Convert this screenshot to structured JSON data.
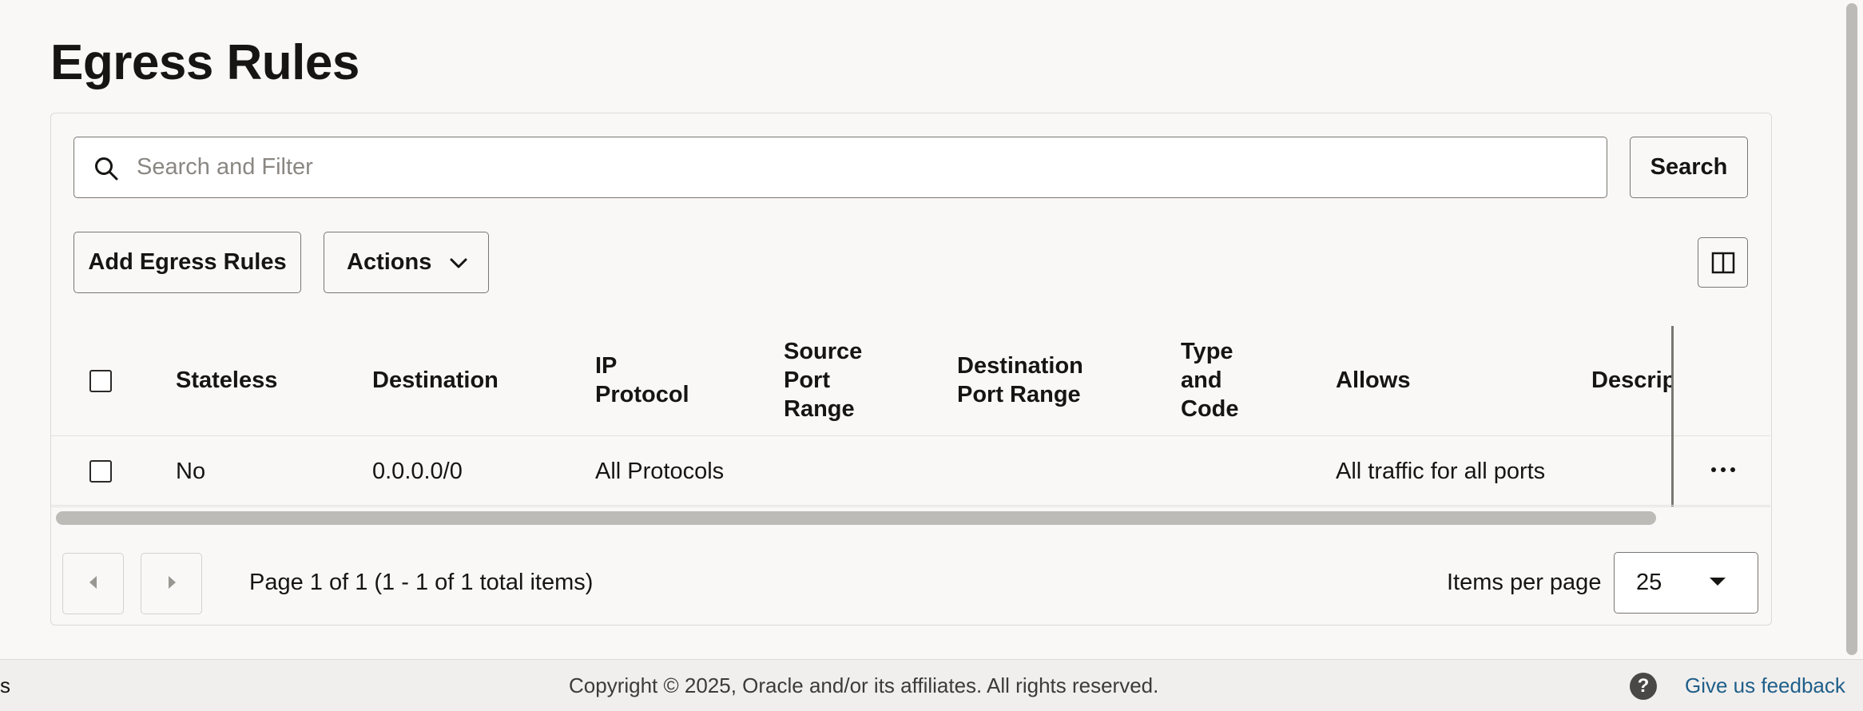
{
  "page": {
    "title": "Egress Rules"
  },
  "search": {
    "placeholder": "Search and Filter",
    "button_label": "Search"
  },
  "toolbar": {
    "add_label": "Add Egress Rules",
    "actions_label": "Actions"
  },
  "table": {
    "columns": [
      "Stateless",
      "Destination",
      "IP Protocol",
      "Source Port Range",
      "Destination Port Range",
      "Type and Code",
      "Allows",
      "Descript"
    ],
    "rows": [
      {
        "stateless": "No",
        "destination": "0.0.0.0/0",
        "ip_protocol": "All Protocols",
        "source_port_range": "",
        "destination_port_range": "",
        "type_and_code": "",
        "allows": "All traffic for all ports",
        "description": ""
      }
    ]
  },
  "pagination": {
    "info": "Page 1 of 1 (1 - 1 of 1 total items)",
    "items_per_page_label": "Items per page",
    "items_per_page_value": "25"
  },
  "footer": {
    "left_fragment": "s",
    "copyright": "Copyright © 2025, Oracle and/or its affiliates. All rights reserved.",
    "help_glyph": "?",
    "feedback": "Give us feedback"
  },
  "icons": {
    "search": "search-icon",
    "chevron": "chevron-down-icon",
    "columns": "columns-icon",
    "more": "more-horizontal-icon"
  }
}
